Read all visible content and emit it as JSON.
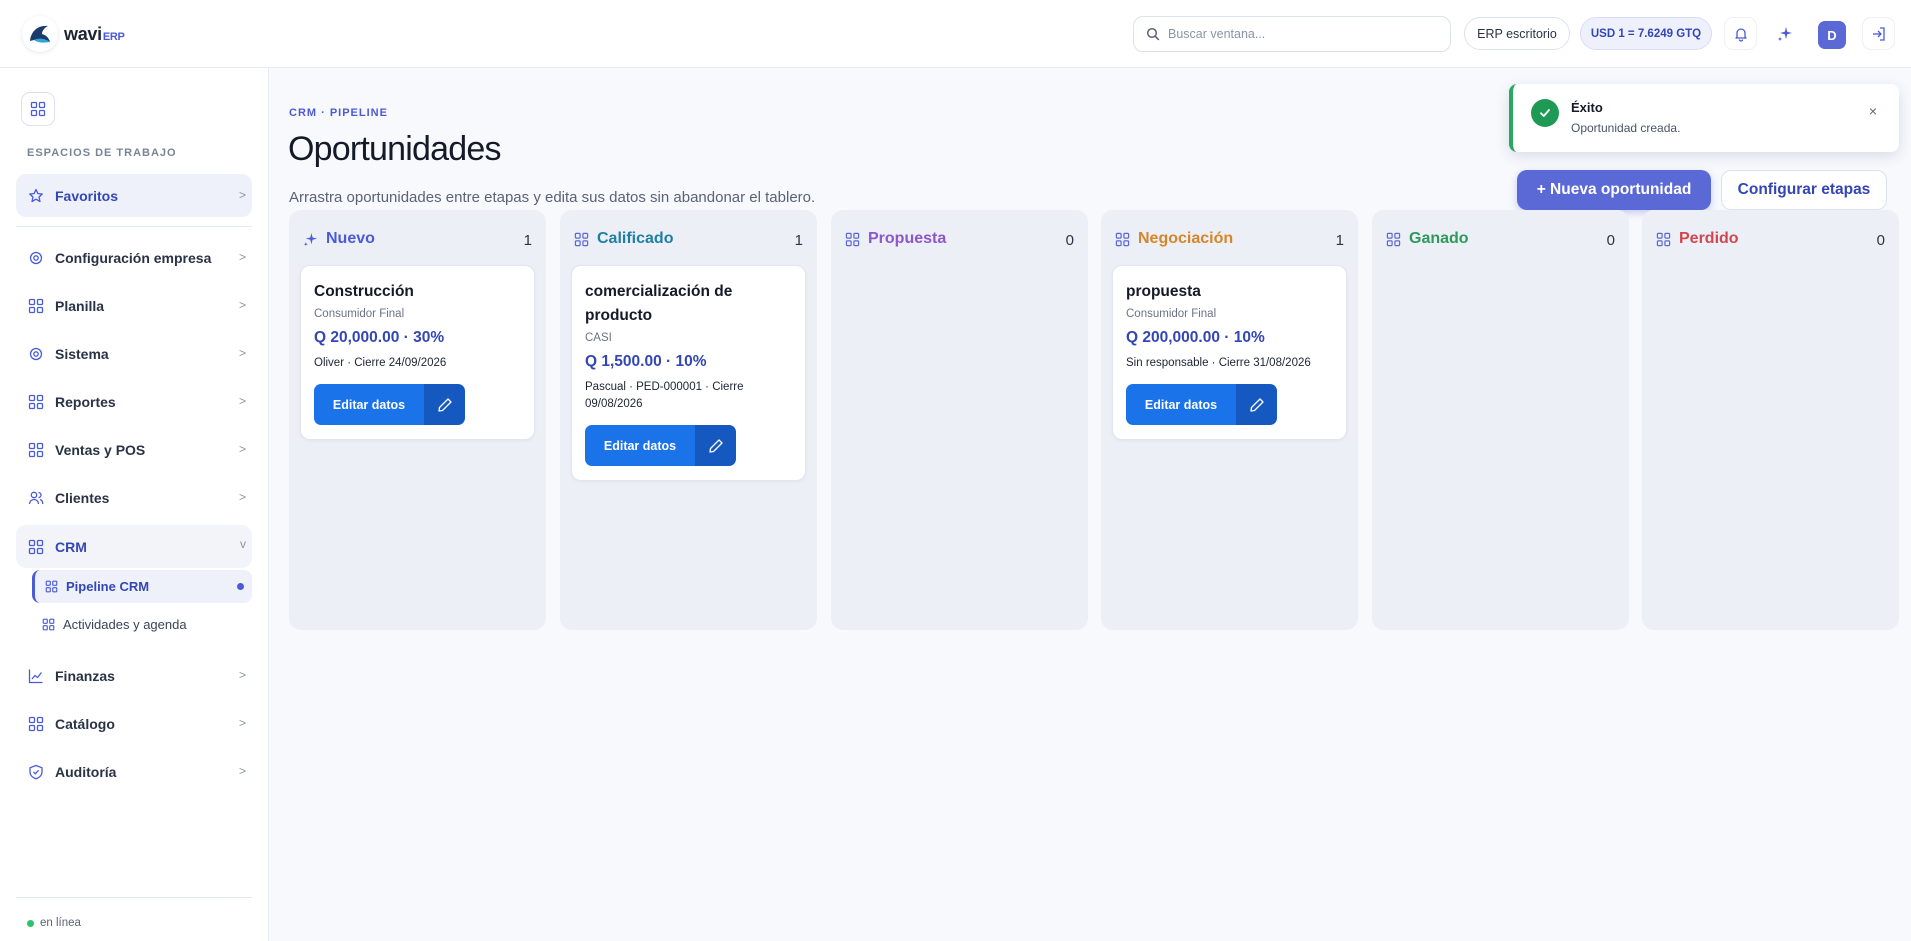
{
  "brand": {
    "name": "wavi",
    "suffix": "ERP"
  },
  "topbar": {
    "search_placeholder": "Buscar ventana...",
    "mode_label": "ERP escritorio",
    "rate_label": "USD 1 = 7.6249 GTQ",
    "avatar_initial": "D"
  },
  "sidebar": {
    "section_label": "ESPACIOS DE TRABAJO",
    "favorites": "Favoritos",
    "items": [
      {
        "label": "Configuración empresa",
        "icon": "settings-icon"
      },
      {
        "label": "Planilla",
        "icon": "grid-icon"
      },
      {
        "label": "Sistema",
        "icon": "settings-icon"
      },
      {
        "label": "Reportes",
        "icon": "grid-icon"
      },
      {
        "label": "Ventas y POS",
        "icon": "grid-icon"
      },
      {
        "label": "Clientes",
        "icon": "users-icon"
      },
      {
        "label": "CRM",
        "icon": "grid-icon"
      }
    ],
    "crm_sub": [
      {
        "label": "Pipeline CRM"
      },
      {
        "label": "Actividades y agenda"
      }
    ],
    "bottom_items": [
      {
        "label": "Finanzas",
        "icon": "chart-icon"
      },
      {
        "label": "Catálogo",
        "icon": "grid-icon"
      },
      {
        "label": "Auditoría",
        "icon": "shield-icon"
      }
    ],
    "status": "en línea"
  },
  "page": {
    "breadcrumb": "CRM · PIPELINE",
    "title": "Oportunidades",
    "description": "Arrastra oportunidades entre etapas y edita sus datos sin abandonar el tablero.",
    "new_button": "+ Nueva oportunidad",
    "config_button": "Configurar etapas"
  },
  "columns": [
    {
      "name": "Nuevo",
      "count": "1",
      "color": "#4a5bd6"
    },
    {
      "name": "Calificado",
      "count": "1",
      "color": "#1f7fa3"
    },
    {
      "name": "Propuesta",
      "count": "0",
      "color": "#8e57c9"
    },
    {
      "name": "Negociación",
      "count": "1",
      "color": "#d5862a"
    },
    {
      "name": "Ganado",
      "count": "0",
      "color": "#2b9a5a"
    },
    {
      "name": "Perdido",
      "count": "0",
      "color": "#d0474f"
    }
  ],
  "cards": {
    "c1": {
      "title": "Construcción",
      "client": "Consumidor Final",
      "amount": "Q 20,000.00 · 30%",
      "meta": "Oliver · Cierre 24/09/2026",
      "edit_label": "Editar datos"
    },
    "c2": {
      "title": "comercialización de producto",
      "client": "CASI",
      "amount": "Q 1,500.00 · 10%",
      "meta": "Pascual · PED-000001 · Cierre 09/08/2026",
      "edit_label": "Editar datos"
    },
    "c3": {
      "title": "propuesta",
      "client": "Consumidor Final",
      "amount": "Q 200,000.00 · 10%",
      "meta": "Sin responsable · Cierre 31/08/2026",
      "edit_label": "Editar datos"
    }
  },
  "toast": {
    "title": "Éxito",
    "message": "Oportunidad creada.",
    "close": "×"
  },
  "colors": {
    "accent": "#4a5bd6",
    "primary_button": "#5b69d6",
    "edit_button": "#1a73e8",
    "success": "#1f9a55"
  }
}
